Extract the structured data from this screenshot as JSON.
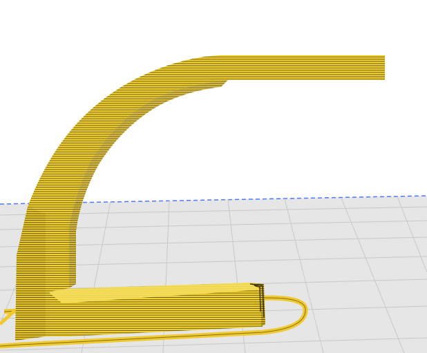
{
  "viewport": {
    "label": "",
    "background_color": "#ffffff",
    "build_plate_color": "#e6e6e6",
    "grid_line_color": "#c8c8c8",
    "plate_edge_color": "#4a78ff",
    "model_color": "#f5d333",
    "model_shadow_color": "#b89a12",
    "layer_line_color": "#3b3305",
    "skirt_color": "#f0c92e"
  }
}
